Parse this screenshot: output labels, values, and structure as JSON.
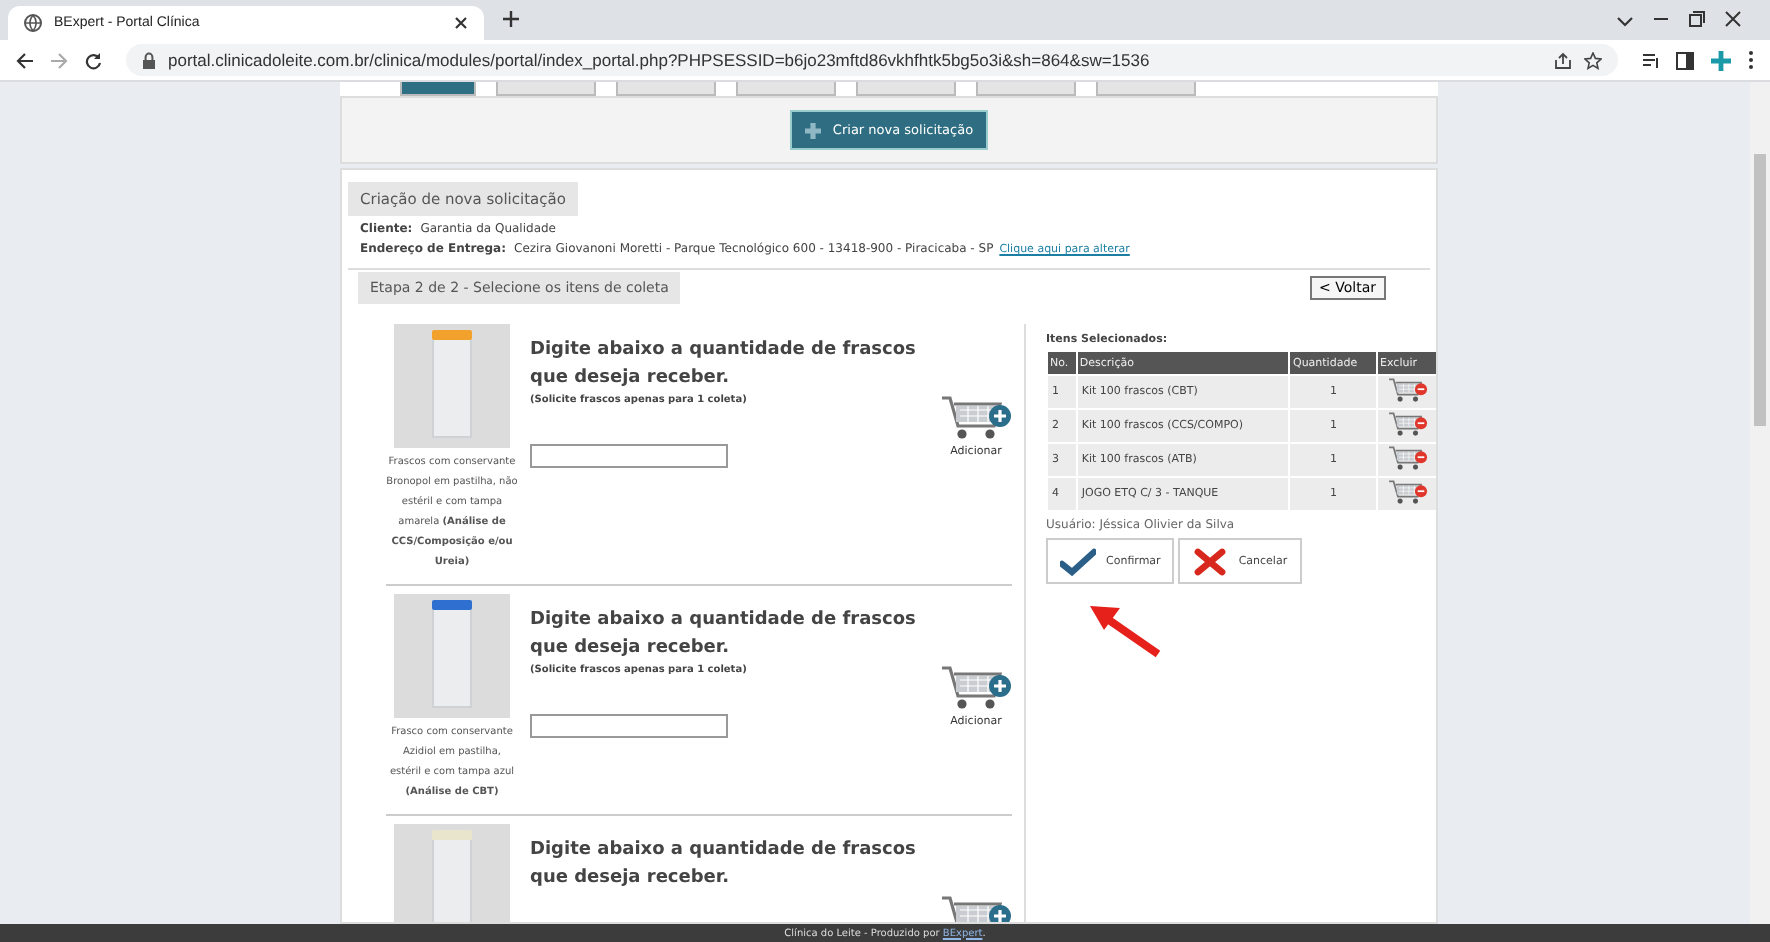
{
  "browser": {
    "tab_title": "BExpert - Portal Clínica",
    "url": "portal.clinicadoleite.com.br/clinica/modules/portal/index_portal.php?PHPSESSID=b6jo23mftd86vkhfhtk5bg5o3i&sh=864&sw=1536"
  },
  "create_button": "Criar nova solicitação",
  "section_title": "Criação de nova solicitação",
  "client": {
    "label": "Cliente:",
    "value": "Garantia da Qualidade"
  },
  "address": {
    "label": "Endereço de Entrega:",
    "value": "Cezira Giovanoni Moretti - Parque Tecnológico  600 - 13418-900 - Piracicaba - SP",
    "link": "Clique aqui para alterar"
  },
  "step_title": "Etapa 2 de 2 - Selecione os itens de coleta",
  "back_button": "< Voltar",
  "products": [
    {
      "color": "#f2a22c",
      "caption": "Frascos com conservante Bronopol em pastilha, não estéril e com tampa amarela **(Análise de CCS/Composição e/ou Ureia)**",
      "heading": "Digite abaixo a quantidade de frascos que deseja receber.",
      "note": "(Solicite frascos apenas para 1 coleta)",
      "add_label": "Adicionar"
    },
    {
      "color": "#2f6fd0",
      "caption": "Frasco com conservante Azidiol em pastilha, estéril e com tampa azul **(Análise de CBT)**",
      "heading": "Digite abaixo a quantidade de frascos que deseja receber.",
      "note": "(Solicite frascos apenas para 1 coleta)",
      "add_label": "Adicionar"
    },
    {
      "color": "#e9e4cc",
      "heading": "Digite abaixo a quantidade de frascos que deseja receber."
    }
  ],
  "selected": {
    "title": "Itens Selecionados:",
    "columns": [
      "No.",
      "Descrição",
      "Quantidade",
      "Excluir"
    ],
    "rows": [
      {
        "no": "1",
        "description": "Kit 100 frascos (CBT)",
        "quantity": "1"
      },
      {
        "no": "2",
        "description": "Kit 100 frascos (CCS/COMPO)",
        "quantity": "1"
      },
      {
        "no": "3",
        "description": "Kit 100 frascos (ATB)",
        "quantity": "1"
      },
      {
        "no": "4",
        "description": "JOGO ETQ C/ 3 - TANQUE",
        "quantity": "1"
      }
    ]
  },
  "user": "Usuário: Jéssica Olivier da Silva",
  "buttons": [
    {
      "kind": "confirm",
      "label": "Confirmar"
    },
    {
      "kind": "cancel",
      "label": "Cancelar"
    }
  ],
  "footer": {
    "text": "Clínica do Leite - Produzido por",
    "link": "BExpert",
    "after": "."
  }
}
